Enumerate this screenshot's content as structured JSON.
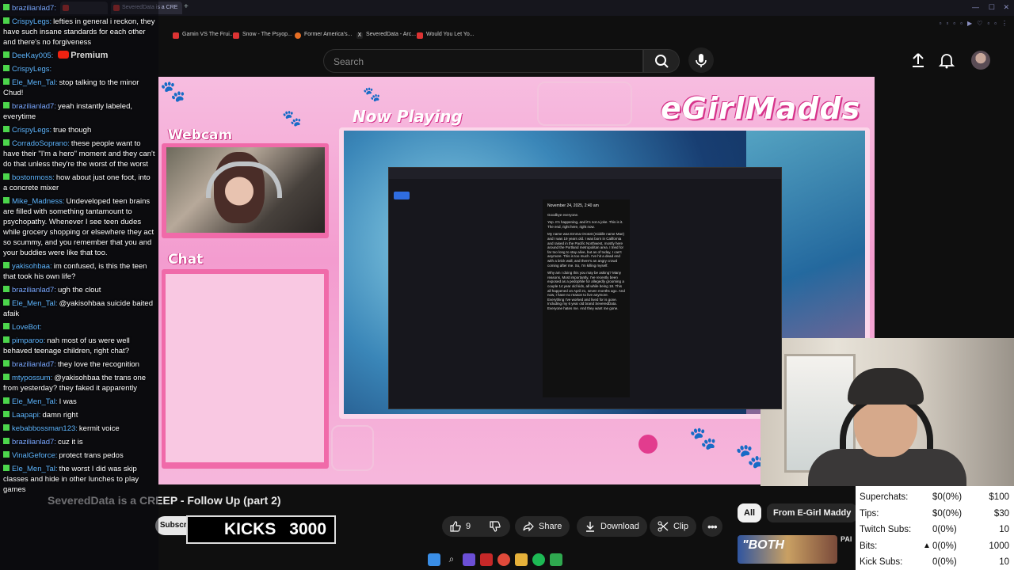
{
  "browser": {
    "tabs": [
      {
        "label": "brazilianlad7"
      },
      {
        "label": "SeveredData is a CRE"
      }
    ],
    "bookmarks": [
      {
        "label": "Gamin VS The Frui..."
      },
      {
        "label": "Snow - The Psyop..."
      },
      {
        "label": "Former America's..."
      },
      {
        "label": "SeveredData - Arc..."
      },
      {
        "label": "Would You Let Yo..."
      }
    ]
  },
  "youtube": {
    "search_placeholder": "Search",
    "video_title": "SeveredData is a CREEP - Follow Up (part 2)",
    "subscribe_label": "Subscribe",
    "like_count": "9",
    "share_label": "Share",
    "download_label": "Download",
    "clip_label": "Clip",
    "chip_all": "All",
    "chip_channel": "From E-Girl Maddy",
    "thumb_text": "\"BOTH",
    "thumb_side": "PAI"
  },
  "stream_overlay": {
    "brand": "eGirlMadds",
    "now_playing": "Now Playing",
    "webcam_label": "Webcam",
    "chat_label": "Chat",
    "note_date": "November 24, 2025, 2:40 am",
    "note_paragraphs": [
      "Goodbye everyone.",
      "Yep. It's happening, and it's not a joke. This is it. The end, right here, right now.",
      "My name was Emma Orotott (middle name Mae) and I was 19 years old. I was born in California and raised in the Pacific Northwest, mostly here around the Portland metropolitan area. I tried for far too long to stay alive, but as of today, I can't anymore. This is too much. I've hit a dead end with a brick wall, and there's an angry crowd coming after me. So, I'm killing myself.",
      "Why am I doing this you may be asking? Many reasons. Most importantly, I've recently been exposed as a pedophile for allegedly grooming a couple 14 year old kids, all while being 18. This all happened on April 21, seven months ago. And now, I have no reason to live anymore. Everything I've worked and lived for is gone. Including my 6 year old brand SeveredData. Everyone hates me. And they want me gone."
    ]
  },
  "kicks": {
    "label": "KICKS",
    "value": "3000"
  },
  "goals": [
    {
      "label": "Superchats:",
      "current": "$0(0%)",
      "target": "$100"
    },
    {
      "label": "Tips:",
      "current": "$0(0%)",
      "target": "$30"
    },
    {
      "label": "Twitch Subs:",
      "current": "0(0%)",
      "target": "10"
    },
    {
      "label": "Bits:",
      "current": "0(0%)",
      "target": "1000"
    },
    {
      "label": "Kick Subs:",
      "current": "0(0%)",
      "target": "10"
    }
  ],
  "chat": {
    "premium_label": "Premium",
    "messages": [
      {
        "user": "brazilianlad7:",
        "text": "",
        "color": "#7aa7ff"
      },
      {
        "user": "CrispyLegs:",
        "text": "lefties in general i reckon, they have such insane standards for each other and there's no forgiveness",
        "color": "#5fb6ff"
      },
      {
        "user": "DeeKay005:",
        "text": "",
        "color": "#5fb6ff"
      },
      {
        "user": "CrispyLegs:",
        "text": "",
        "color": "#5fb6ff"
      },
      {
        "user": "Ele_Men_Tal:",
        "text": "stop talking to the minor Chud!",
        "color": "#5fb6ff"
      },
      {
        "user": "brazilianlad7:",
        "text": "yeah instantly labeled, everytime",
        "color": "#7aa7ff"
      },
      {
        "user": "CrispyLegs:",
        "text": "true though",
        "color": "#5fb6ff"
      },
      {
        "user": "CorradoSoprano:",
        "text": "these people want to have their \"I'm a hero\" moment and they can't do that unless they're the worst of the worst",
        "color": "#5fb6ff"
      },
      {
        "user": "bostonmoss:",
        "text": "how about just one foot, into a concrete mixer",
        "color": "#5fb6ff"
      },
      {
        "user": "Mike_Madness:",
        "text": "Undeveloped teen brains are filled with something tantamount to psychopathy. Whenever I see teen dudes while grocery shopping or elsewhere they act so scummy, and you remember that you and your buddies were like that too.",
        "color": "#5fb6ff"
      },
      {
        "user": "yakisohbaa:",
        "text": "im confused, is this the teen that took his own life?",
        "color": "#5fb6ff"
      },
      {
        "user": "brazilianlad7:",
        "text": "ugh the clout",
        "color": "#7aa7ff"
      },
      {
        "user": "Ele_Men_Tal:",
        "text": "@yakisohbaa suicide baited afaik",
        "color": "#5fb6ff"
      },
      {
        "user": "LoveBot:",
        "text": "",
        "color": "#5fb6ff"
      },
      {
        "user": "pimparoo:",
        "text": "nah most of us were well behaved teenage children, right chat?",
        "color": "#5fb6ff"
      },
      {
        "user": "brazilianlad7:",
        "text": "they love the recognition",
        "color": "#7aa7ff"
      },
      {
        "user": "mtypossum:",
        "text": "@yakisohbaa the trans one from yesterday? they faked it apparently",
        "color": "#5fb6ff"
      },
      {
        "user": "Ele_Men_Tal:",
        "text": "I was",
        "color": "#5fb6ff"
      },
      {
        "user": "Laapapi:",
        "text": "damn right",
        "color": "#5fb6ff"
      },
      {
        "user": "kebabbossman123:",
        "text": "kermit voice",
        "color": "#5fb6ff"
      },
      {
        "user": "brazilianlad7:",
        "text": "cuz it is",
        "color": "#7aa7ff"
      },
      {
        "user": "VinalGeforce:",
        "text": "protect trans pedos",
        "color": "#5fb6ff"
      },
      {
        "user": "Ele_Men_Tal:",
        "text": "the worst I did was skip classes and hide in other lunches to play games",
        "color": "#5fb6ff"
      }
    ]
  },
  "colors": {
    "accent_pink": "#e0418f",
    "badge_green": "#4cd64c"
  }
}
